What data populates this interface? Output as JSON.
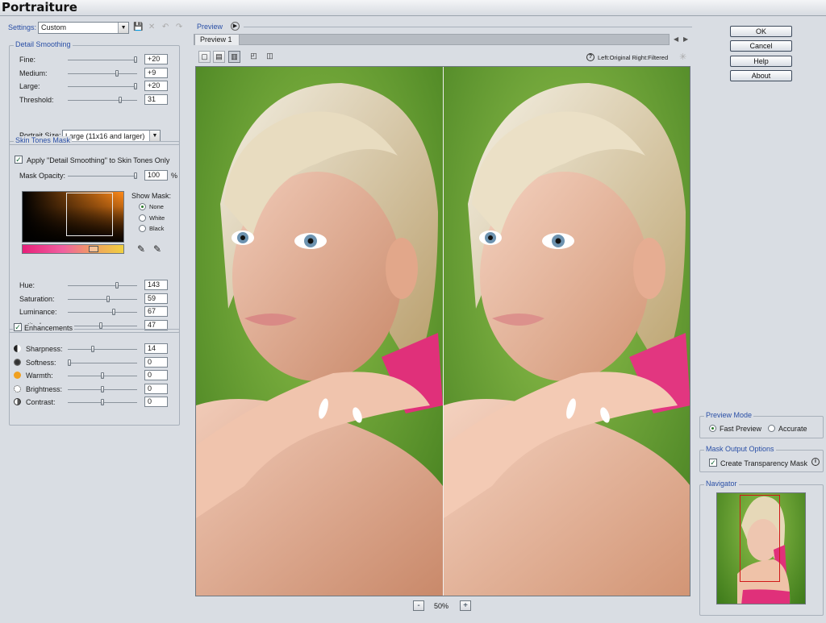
{
  "app": {
    "title": "Portraiture"
  },
  "settings": {
    "label": "Settings:",
    "preset": "Custom"
  },
  "detail_smoothing": {
    "legend": "Detail Smoothing",
    "rows": [
      {
        "label": "Fine:",
        "value": "+20",
        "level": 1.0
      },
      {
        "label": "Medium:",
        "value": "+9",
        "level": 0.72
      },
      {
        "label": "Large:",
        "value": "+20",
        "level": 1.0
      },
      {
        "label": "Threshold:",
        "value": "31",
        "level": 0.77
      }
    ],
    "portrait_size_label": "Portrait Size:",
    "portrait_size": "Large (11x16 and larger)"
  },
  "skin_tones": {
    "legend": "Skin Tones Mask",
    "apply_label": "Apply \"Detail Smoothing\" to Skin Tones Only",
    "apply_checked": true,
    "mask_opacity_label": "Mask Opacity:",
    "mask_opacity": "100",
    "mask_opacity_unit": "%",
    "show_mask_label": "Show Mask:",
    "show_mask_options": [
      "None",
      "White",
      "Black"
    ],
    "show_mask_selected": "None",
    "rows": [
      {
        "label": "Hue:",
        "value": "143",
        "level": 0.72
      },
      {
        "label": "Saturation:",
        "value": "59",
        "level": 0.59
      },
      {
        "label": "Luminance:",
        "value": "67",
        "level": 0.67
      },
      {
        "label": "Latitude:",
        "value": "47",
        "level": 0.47
      }
    ]
  },
  "enhancements": {
    "legend": "Enhancements",
    "checked": true,
    "rows": [
      {
        "label": "Sharpness:",
        "value": "14",
        "level": 0.35,
        "icon": "half-moon-icon",
        "color": "#222222"
      },
      {
        "label": "Softness:",
        "value": "0",
        "level": 0.0,
        "icon": "soft-circle-icon",
        "color": "#333333"
      },
      {
        "label": "Warmth:",
        "value": "0",
        "level": 0.5,
        "icon": "sun-icon",
        "color": "#f0a020"
      },
      {
        "label": "Brightness:",
        "value": "0",
        "level": 0.5,
        "icon": "brightness-icon",
        "color": "#777777"
      },
      {
        "label": "Contrast:",
        "value": "0",
        "level": 0.5,
        "icon": "contrast-icon",
        "color": "#555555"
      }
    ]
  },
  "preview": {
    "legend": "Preview",
    "tab_label": "Preview 1",
    "help_text": "Left:Original Right:Filtered",
    "zoom": "50%",
    "zoom_out": "-",
    "zoom_in": "+"
  },
  "buttons": {
    "ok": "OK",
    "cancel": "Cancel",
    "help": "Help",
    "about": "About"
  },
  "preview_mode": {
    "legend": "Preview Mode",
    "options": [
      "Fast Preview",
      "Accurate"
    ],
    "selected": "Fast Preview"
  },
  "mask_output": {
    "legend": "Mask Output Options",
    "transparency_label": "Create Transparency Mask",
    "checked": true
  },
  "navigator": {
    "legend": "Navigator"
  },
  "colors": {
    "accent": "#2a4fa6",
    "background": "#d9dde3",
    "navigator_box": "#d01818"
  }
}
